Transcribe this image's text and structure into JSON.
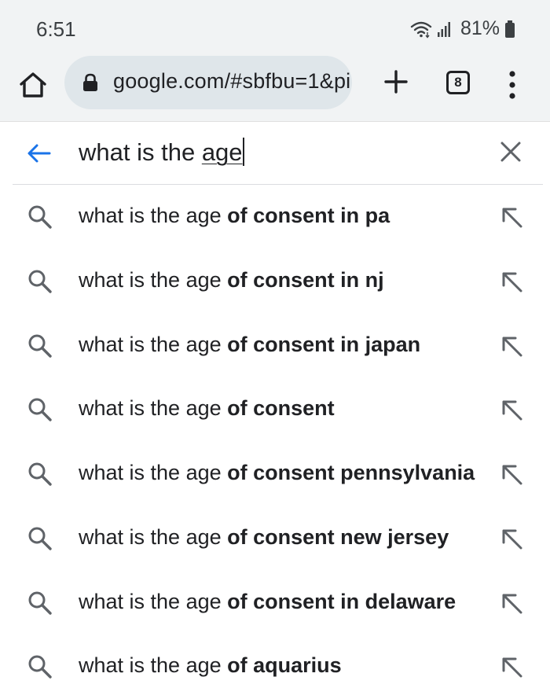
{
  "status_bar": {
    "time": "6:51",
    "battery": "81%"
  },
  "toolbar": {
    "url": "google.com/#sbfbu=1&pi",
    "tab_count": "8",
    "icons": [
      "home-icon",
      "lock-icon",
      "plus-icon",
      "tab-switcher-icon",
      "more-vert-icon"
    ]
  },
  "search": {
    "query_prefix": "what is the ",
    "query_underlined": "age"
  },
  "suggestions": [
    {
      "prefix": "what is the age ",
      "bold": "of consent in pa"
    },
    {
      "prefix": "what is the age ",
      "bold": "of consent in nj"
    },
    {
      "prefix": "what is the age ",
      "bold": "of consent in japan"
    },
    {
      "prefix": "what is the age ",
      "bold": "of consent"
    },
    {
      "prefix": "what is the age ",
      "bold": "of consent pennsylvania"
    },
    {
      "prefix": "what is the age ",
      "bold": "of consent new jersey"
    },
    {
      "prefix": "what is the age ",
      "bold": "of consent in delaware"
    },
    {
      "prefix": "what is the age ",
      "bold": "of aquarius"
    }
  ],
  "colors": {
    "accent": "#1a73e8",
    "icon_gray": "#5f6368",
    "bar_bg": "#f1f3f4",
    "omnibox_bg": "#dfe6ea"
  }
}
